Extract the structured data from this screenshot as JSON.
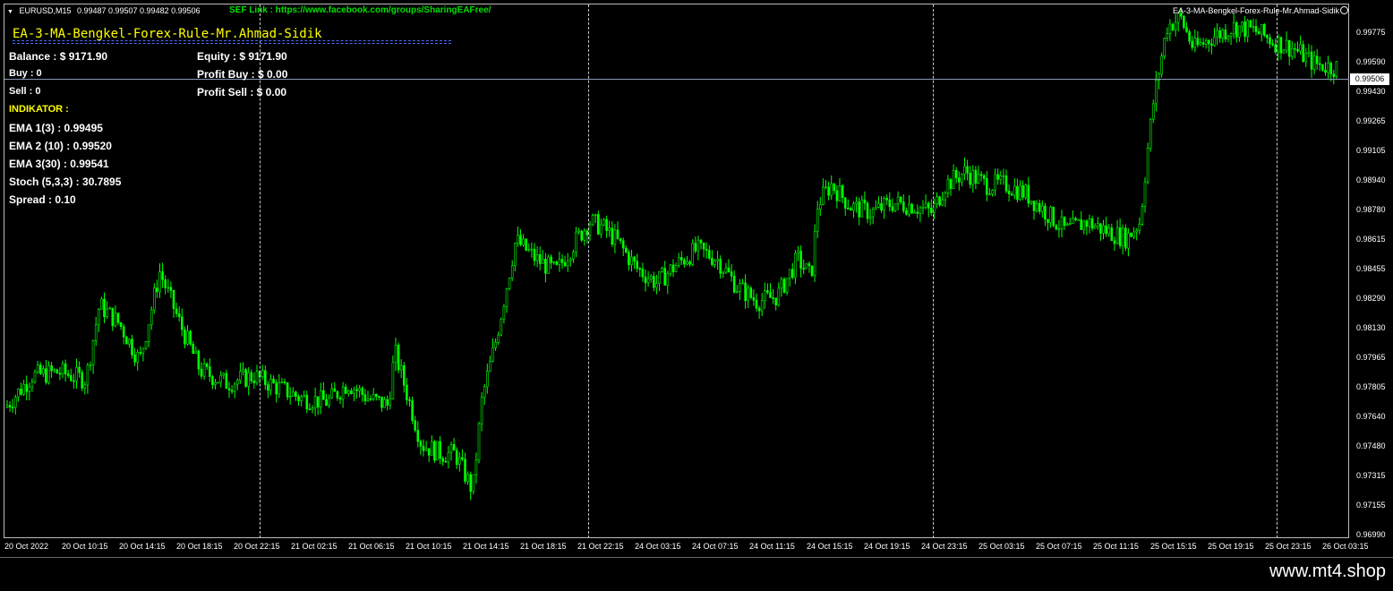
{
  "symbol_bar": {
    "symbol": "EURUSD,M15",
    "ohlc": "0.99487 0.99507 0.99482 0.99506"
  },
  "sef_link": "SEF Link : https://www.facebook.com/groups/SharingEAFree/",
  "ea_name_right": "EA-3-MA-Bengkel-Forex-Rule-Mr.Ahmad-Sidik",
  "ea_title": "EA-3-MA-Bengkel-Forex-Rule-Mr.Ahmad-Sidik",
  "panel": {
    "balance": "Balance : $ 9171.90",
    "equity": "Equity : $ 9171.90",
    "buy": "Buy   : 0",
    "profit_buy": "Profit Buy   : $ 0.00",
    "sell": "Sell   : 0",
    "profit_sell": "Profit Sell  : $ 0.00",
    "indikator": "INDIKATOR :",
    "ema1": "EMA 1(3) : 0.99495",
    "ema2": "EMA 2 (10) : 0.99520",
    "ema3": "EMA 3(30) : 0.99541",
    "stoch": "Stoch (5,3,3) : 30.7895",
    "spread": "Spread : 0.10"
  },
  "current_price": "0.99506",
  "watermark": "www.mt4.shop",
  "icons": {
    "smile": "smiley-face-icon",
    "dropdown": "triangle-down-icon"
  },
  "colors": {
    "candle": "#00ff00",
    "title": "#ffff00",
    "link": "#00e000",
    "underline": "#4a6bff"
  },
  "chart_data": {
    "type": "candlestick",
    "price_ticks": [
      "0.99775",
      "0.99590",
      "0.99430",
      "0.99265",
      "0.99105",
      "0.98940",
      "0.98780",
      "0.98615",
      "0.98455",
      "0.98290",
      "0.98130",
      "0.97965",
      "0.97805",
      "0.97640",
      "0.97480",
      "0.97315",
      "0.97155",
      "0.96990"
    ],
    "time_ticks": [
      "20 Oct 2022",
      "20 Oct 10:15",
      "20 Oct 14:15",
      "20 Oct 18:15",
      "20 Oct 22:15",
      "21 Oct 02:15",
      "21 Oct 06:15",
      "21 Oct 10:15",
      "21 Oct 14:15",
      "21 Oct 18:15",
      "21 Oct 22:15",
      "24 Oct 03:15",
      "24 Oct 07:15",
      "24 Oct 11:15",
      "24 Oct 15:15",
      "24 Oct 19:15",
      "24 Oct 23:15",
      "25 Oct 03:15",
      "25 Oct 07:15",
      "25 Oct 11:15",
      "25 Oct 15:15",
      "25 Oct 19:15",
      "25 Oct 23:15",
      "26 Oct 03:15"
    ],
    "ylim": [
      0.9694,
      0.9982
    ],
    "price_path": [
      [
        0,
        0.9765
      ],
      [
        0.02,
        0.9782
      ],
      [
        0.04,
        0.9784
      ],
      [
        0.06,
        0.978
      ],
      [
        0.07,
        0.982
      ],
      [
        0.085,
        0.981
      ],
      [
        0.1,
        0.979
      ],
      [
        0.115,
        0.9838
      ],
      [
        0.13,
        0.981
      ],
      [
        0.145,
        0.9785
      ],
      [
        0.165,
        0.9778
      ],
      [
        0.185,
        0.9782
      ],
      [
        0.205,
        0.9775
      ],
      [
        0.22,
        0.977
      ],
      [
        0.24,
        0.9768
      ],
      [
        0.255,
        0.9778
      ],
      [
        0.27,
        0.977
      ],
      [
        0.285,
        0.9766
      ],
      [
        0.29,
        0.9795
      ],
      [
        0.3,
        0.977
      ],
      [
        0.31,
        0.9745
      ],
      [
        0.325,
        0.974
      ],
      [
        0.335,
        0.974
      ],
      [
        0.348,
        0.972
      ],
      [
        0.355,
        0.977
      ],
      [
        0.365,
        0.98
      ],
      [
        0.38,
        0.9855
      ],
      [
        0.395,
        0.9845
      ],
      [
        0.41,
        0.9838
      ],
      [
        0.425,
        0.9855
      ],
      [
        0.435,
        0.9865
      ],
      [
        0.445,
        0.9862
      ],
      [
        0.455,
        0.9855
      ],
      [
        0.47,
        0.984
      ],
      [
        0.485,
        0.9832
      ],
      [
        0.5,
        0.9842
      ],
      [
        0.515,
        0.985
      ],
      [
        0.53,
        0.9845
      ],
      [
        0.545,
        0.983
      ],
      [
        0.56,
        0.9822
      ],
      [
        0.575,
        0.9825
      ],
      [
        0.59,
        0.9845
      ],
      [
        0.6,
        0.9835
      ],
      [
        0.605,
        0.9875
      ],
      [
        0.615,
        0.9885
      ],
      [
        0.63,
        0.9873
      ],
      [
        0.645,
        0.987
      ],
      [
        0.66,
        0.9875
      ],
      [
        0.675,
        0.9874
      ],
      [
        0.69,
        0.987
      ],
      [
        0.7,
        0.9885
      ],
      [
        0.715,
        0.9892
      ],
      [
        0.73,
        0.9885
      ],
      [
        0.745,
        0.9885
      ],
      [
        0.76,
        0.988
      ],
      [
        0.775,
        0.987
      ],
      [
        0.79,
        0.986
      ],
      [
        0.805,
        0.9865
      ],
      [
        0.82,
        0.986
      ],
      [
        0.835,
        0.9856
      ],
      [
        0.845,
        0.9865
      ],
      [
        0.85,
        0.99
      ],
      [
        0.855,
        0.993
      ],
      [
        0.86,
        0.995
      ],
      [
        0.865,
        0.997
      ],
      [
        0.875,
        0.9975
      ],
      [
        0.885,
        0.9958
      ],
      [
        0.9,
        0.9965
      ],
      [
        0.915,
        0.997
      ],
      [
        0.93,
        0.9968
      ],
      [
        0.945,
        0.9962
      ],
      [
        0.96,
        0.9958
      ],
      [
        0.975,
        0.995
      ],
      [
        0.99,
        0.9948
      ],
      [
        1,
        0.995
      ]
    ]
  }
}
